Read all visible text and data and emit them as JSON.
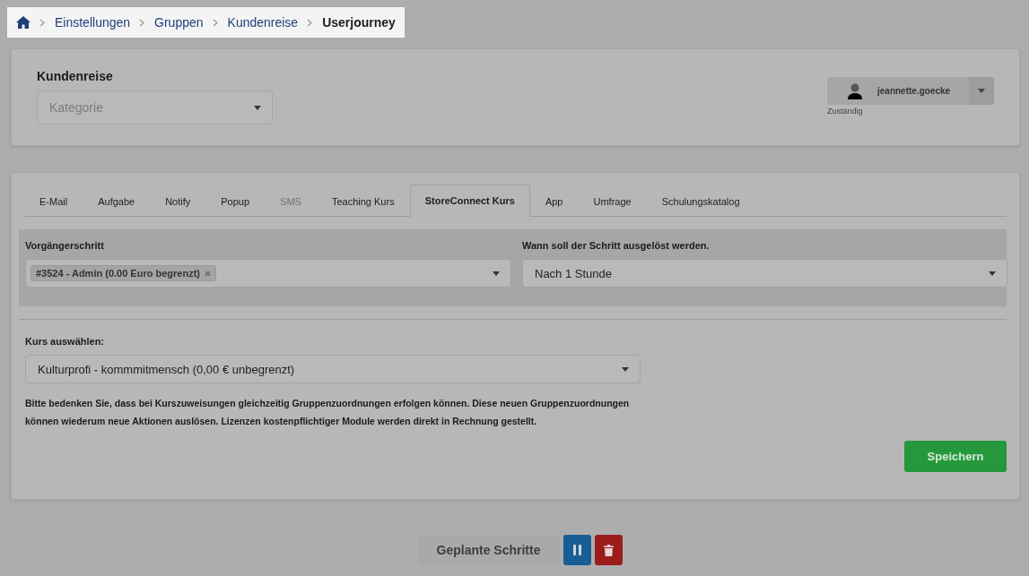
{
  "breadcrumb": {
    "items": [
      {
        "label": "Einstellungen",
        "current": false
      },
      {
        "label": "Gruppen",
        "current": false
      },
      {
        "label": "Kundenreise",
        "current": false
      },
      {
        "label": "Userjourney",
        "current": true
      }
    ]
  },
  "header": {
    "title": "Kundenreise",
    "category": {
      "placeholder": "Kategorie"
    },
    "assignee": {
      "name": "jeannette.goecke",
      "caption": "Zuständig"
    }
  },
  "tabs": [
    {
      "label": "E-Mail",
      "selected": false,
      "disabled": false
    },
    {
      "label": "Aufgabe",
      "selected": false,
      "disabled": false
    },
    {
      "label": "Notify",
      "selected": false,
      "disabled": false
    },
    {
      "label": "Popup",
      "selected": false,
      "disabled": false
    },
    {
      "label": "SMS",
      "selected": false,
      "disabled": true
    },
    {
      "label": "Teaching Kurs",
      "selected": false,
      "disabled": false
    },
    {
      "label": "StoreConnect Kurs",
      "selected": true,
      "disabled": false
    },
    {
      "label": "App",
      "selected": false,
      "disabled": false
    },
    {
      "label": "Umfrage",
      "selected": false,
      "disabled": false
    },
    {
      "label": "Schulungskatalog",
      "selected": false,
      "disabled": false
    }
  ],
  "previous_step": {
    "label": "Vorgängerschritt",
    "tags": [
      "#3524 - Admin (0.00 Euro begrenzt)"
    ]
  },
  "trigger": {
    "label": "Wann soll der Schritt ausgelöst werden.",
    "value": "Nach 1 Stunde"
  },
  "course": {
    "label": "Kurs auswählen:",
    "value": "Kulturprofi - kommmitmensch (0,00 € unbegrenzt)"
  },
  "notice": "Bitte bedenken Sie, dass bei Kurszuweisungen gleichzeitig Gruppenzuordnungen erfolgen können. Diese neuen Gruppenzuordnungen können wiederum neue Aktionen auslösen. Lizenzen kostenpflichtiger Module werden direkt in Rechnung gestellt.",
  "save_button": "Speichern",
  "footer": {
    "scheduled_button": "Geplante Schritte"
  }
}
